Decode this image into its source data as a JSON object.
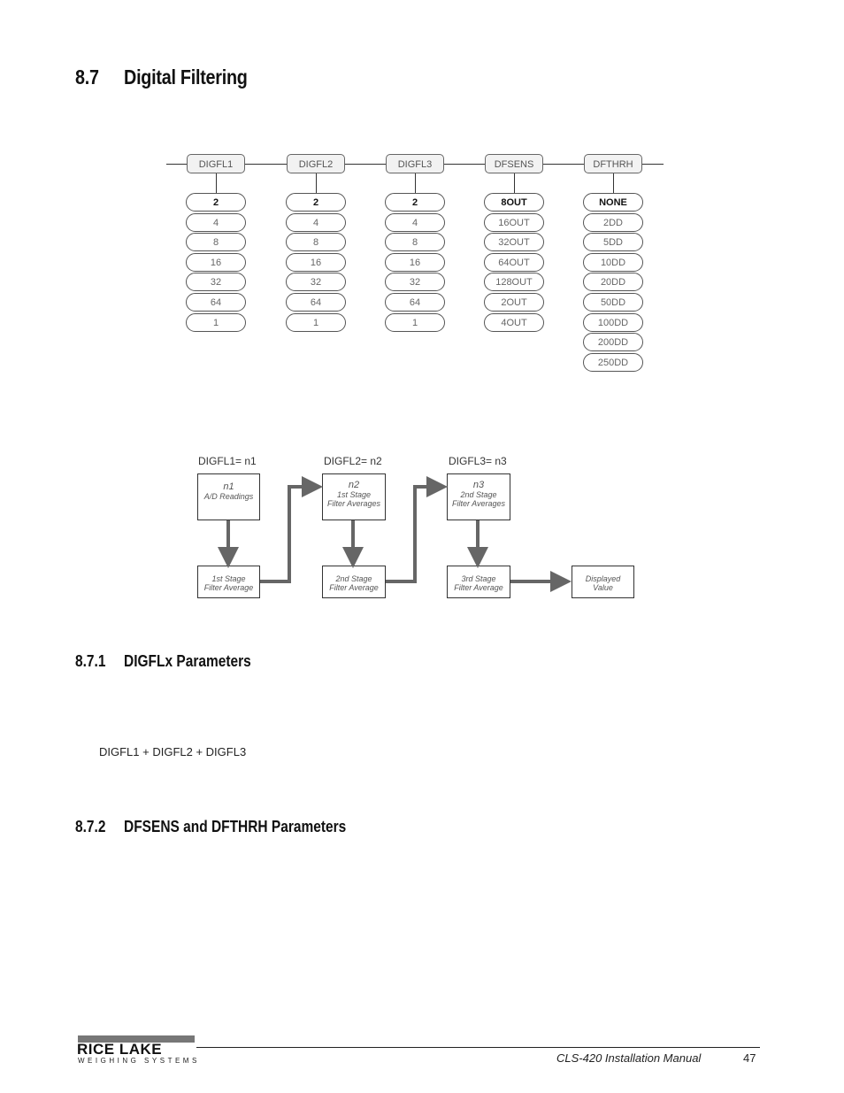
{
  "section": {
    "number": "8.7",
    "title": "Digital Filtering"
  },
  "menu_diagram": {
    "parameters": [
      {
        "name": "DIGFL1",
        "default": "2",
        "options": [
          "2",
          "4",
          "8",
          "16",
          "32",
          "64",
          "1"
        ]
      },
      {
        "name": "DIGFL2",
        "default": "2",
        "options": [
          "2",
          "4",
          "8",
          "16",
          "32",
          "64",
          "1"
        ]
      },
      {
        "name": "DIGFL3",
        "default": "2",
        "options": [
          "2",
          "4",
          "8",
          "16",
          "32",
          "64",
          "1"
        ]
      },
      {
        "name": "DFSENS",
        "default": "8OUT",
        "options": [
          "8OUT",
          "16OUT",
          "32OUT",
          "64OUT",
          "128OUT",
          "2OUT",
          "4OUT"
        ]
      },
      {
        "name": "DFTHRH",
        "default": "NONE",
        "options": [
          "NONE",
          "2DD",
          "5DD",
          "10DD",
          "20DD",
          "50DD",
          "100DD",
          "200DD",
          "250DD"
        ]
      }
    ]
  },
  "flow_diagram": {
    "labels": [
      "DIGFL1= n1",
      "DIGFL2= n2",
      "DIGFL3= n3"
    ],
    "top_boxes": [
      {
        "title": "n1",
        "line1": "A/D Readings",
        "line2": ""
      },
      {
        "title": "n2",
        "line1": "1st Stage",
        "line2": "Filter Averages"
      },
      {
        "title": "n3",
        "line1": "2nd Stage",
        "line2": "Filter Averages"
      }
    ],
    "bottom_boxes": [
      {
        "line1": "1st Stage",
        "line2": "Filter Average"
      },
      {
        "line1": "2nd Stage",
        "line2": "Filter Average"
      },
      {
        "line1": "3rd Stage",
        "line2": "Filter Average"
      },
      {
        "line1": "Displayed",
        "line2": "Value"
      }
    ]
  },
  "subsection1": {
    "number": "8.7.1",
    "title": "DIGFLx Parameters",
    "formula": "DIGFL1 + DIGFL2 + DIGFL3"
  },
  "subsection2": {
    "number": "8.7.2",
    "title": "DFSENS and DFTHRH Parameters"
  },
  "footer": {
    "logo": "RICE LAKE",
    "logo_sub": "WEIGHING SYSTEMS",
    "manual_title": "CLS-420 Installation Manual",
    "page": "47"
  }
}
